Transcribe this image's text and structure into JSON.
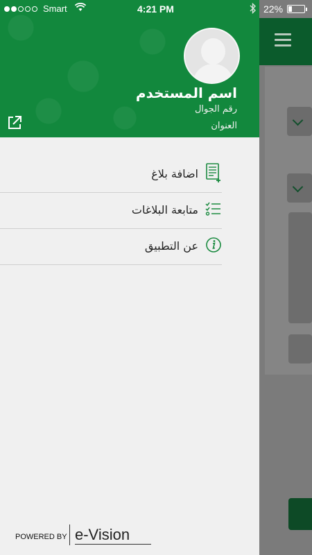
{
  "status_bar": {
    "carrier": "Smart",
    "time": "4:21 PM",
    "battery": "22%",
    "battery_level": 0.22
  },
  "drawer": {
    "user_name": "اسم المستخدم",
    "user_phone": "رقم الجوال",
    "user_address": "العنوان",
    "menu": [
      {
        "label": "اضافة بلاغ",
        "icon": "add-report-icon"
      },
      {
        "label": "متابعة البلاغات",
        "icon": "checklist-icon"
      },
      {
        "label": "عن التطبيق",
        "icon": "info-icon"
      }
    ],
    "powered_by": "POWERED BY",
    "brand": "e-Vision"
  },
  "colors": {
    "header_green": "#12883d",
    "dark_green": "#0b5b2c",
    "icon_green": "#1a8a3f"
  }
}
